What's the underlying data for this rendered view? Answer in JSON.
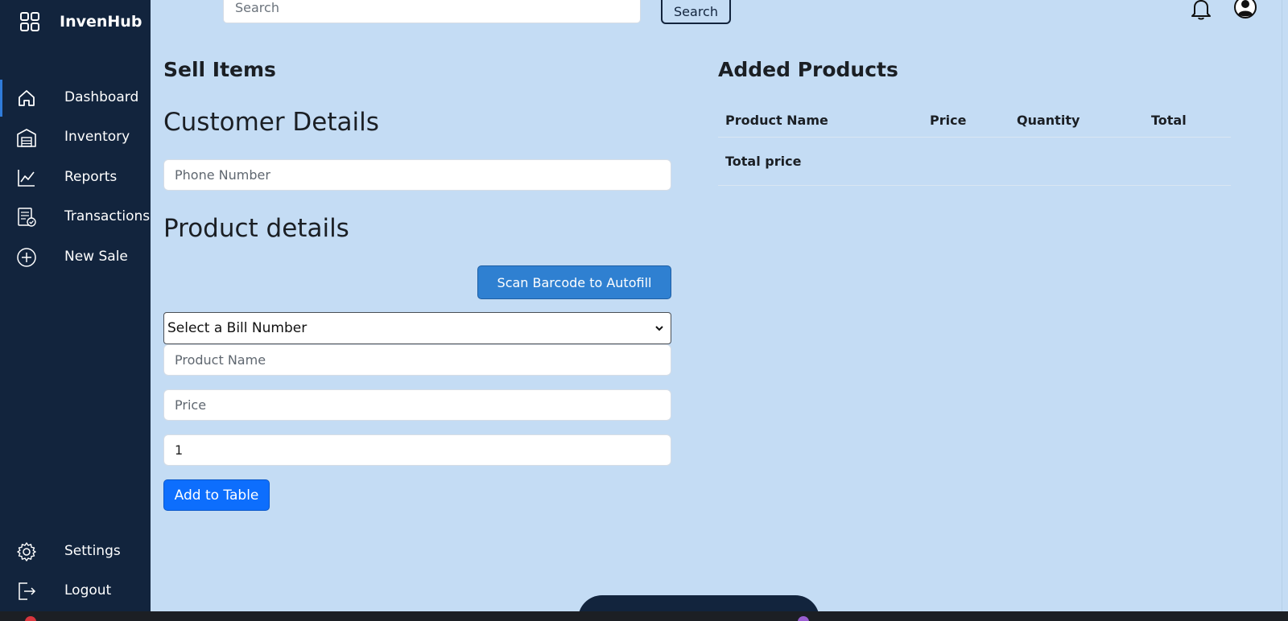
{
  "app": {
    "name": "InvenHub"
  },
  "topbar": {
    "search_placeholder": "Search",
    "search_button": "Search"
  },
  "sidebar": {
    "items": [
      {
        "label": "Dashboard",
        "icon": "home-icon"
      },
      {
        "label": "Inventory",
        "icon": "warehouse-icon"
      },
      {
        "label": "Reports",
        "icon": "chart-line-icon"
      },
      {
        "label": "Transactions",
        "icon": "receipt-icon"
      },
      {
        "label": "New Sale",
        "icon": "plus-circle-icon"
      }
    ],
    "bottom_items": [
      {
        "label": "Settings",
        "icon": "gear-icon"
      },
      {
        "label": "Logout",
        "icon": "logout-icon"
      }
    ]
  },
  "sell": {
    "title": "Sell Items",
    "customer_heading": "Customer Details",
    "phone_placeholder": "Phone Number",
    "product_heading": "Product details",
    "scan_button": "Scan Barcode to Autofill",
    "bill_select_value": "Select a Bill Number",
    "product_name_placeholder": "Product Name",
    "price_placeholder": "Price",
    "quantity_value": "1",
    "add_button": "Add to Table"
  },
  "added": {
    "title": "Added Products",
    "columns": [
      "Product Name",
      "Price",
      "Quantity",
      "Total"
    ],
    "total_label": "Total price"
  },
  "colors": {
    "sidebar": "#12243d",
    "background": "#c4dcf4",
    "primary": "#0d6efd",
    "scan": "#2f80d1"
  }
}
